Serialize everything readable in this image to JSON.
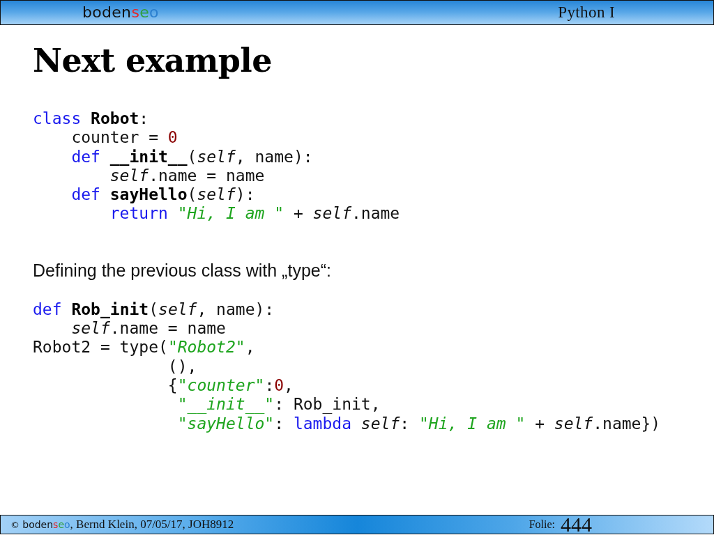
{
  "header": {
    "logo": [
      {
        "text": "boden",
        "color": "#111111"
      },
      {
        "text": "s",
        "color": "#e3262b"
      },
      {
        "text": "e",
        "color": "#2f9e3f"
      },
      {
        "text": "o",
        "color": "#2a7fcf"
      }
    ],
    "course": "Python I"
  },
  "slide": {
    "title": "Next example",
    "blocks": [
      {
        "kind": "code",
        "lines": [
          {
            "tokens": [
              {
                "kind": "kw",
                "text": "class "
              },
              {
                "kind": "name",
                "text": "Robot"
              },
              {
                "kind": "plain",
                "text": ":"
              }
            ],
            "children": [
              {
                "tokens": [
                  {
                    "kind": "plain",
                    "text": "counter = "
                  },
                  {
                    "kind": "num",
                    "text": "0"
                  }
                ]
              },
              {
                "tokens": [
                  {
                    "kind": "kw",
                    "text": "def "
                  },
                  {
                    "kind": "name",
                    "text": "__init__"
                  },
                  {
                    "kind": "plain",
                    "text": "("
                  },
                  {
                    "kind": "self",
                    "text": "self"
                  },
                  {
                    "kind": "plain",
                    "text": ", name):"
                  }
                ],
                "children": [
                  {
                    "tokens": [
                      {
                        "kind": "self",
                        "text": "self"
                      },
                      {
                        "kind": "plain",
                        "text": ".name = name"
                      }
                    ]
                  }
                ]
              },
              {
                "tokens": [
                  {
                    "kind": "kw",
                    "text": "def "
                  },
                  {
                    "kind": "name",
                    "text": "sayHello"
                  },
                  {
                    "kind": "plain",
                    "text": "("
                  },
                  {
                    "kind": "self",
                    "text": "self"
                  },
                  {
                    "kind": "plain",
                    "text": "):"
                  }
                ],
                "children": [
                  {
                    "tokens": [
                      {
                        "kind": "kw",
                        "text": "return "
                      },
                      {
                        "kind": "quote",
                        "text": "\""
                      },
                      {
                        "kind": "str",
                        "text": "Hi, I am "
                      },
                      {
                        "kind": "quote",
                        "text": "\""
                      },
                      {
                        "kind": "plain",
                        "text": " + "
                      },
                      {
                        "kind": "self",
                        "text": "self"
                      },
                      {
                        "kind": "plain",
                        "text": ".name"
                      }
                    ]
                  }
                ]
              }
            ]
          }
        ]
      },
      {
        "kind": "text",
        "text": "Defining the previous class with „type“:"
      },
      {
        "kind": "code",
        "lines": [
          {
            "tokens": [
              {
                "kind": "kw",
                "text": "def "
              },
              {
                "kind": "name",
                "text": "Rob_init"
              },
              {
                "kind": "plain",
                "text": "("
              },
              {
                "kind": "self",
                "text": "self"
              },
              {
                "kind": "plain",
                "text": ", name):"
              }
            ],
            "children": [
              {
                "tokens": [
                  {
                    "kind": "self",
                    "text": "self"
                  },
                  {
                    "kind": "plain",
                    "text": ".name = name"
                  }
                ]
              }
            ]
          },
          {
            "tokens": [
              {
                "kind": "plain",
                "text": "Robot2 = type"
              },
              {
                "kind": "open",
                "text": "("
              },
              {
                "kind": "quote",
                "text": "\""
              },
              {
                "kind": "str",
                "text": "Robot2"
              },
              {
                "kind": "quote",
                "text": "\""
              },
              {
                "kind": "plain",
                "text": ","
              }
            ],
            "children": [
              {
                "tokens": [
                  {
                    "kind": "plain",
                    "text": "(),"
                  }
                ]
              },
              {
                "tokens": [
                  {
                    "kind": "open",
                    "text": "{"
                  },
                  {
                    "kind": "quote",
                    "text": "\""
                  },
                  {
                    "kind": "str",
                    "text": "counter"
                  },
                  {
                    "kind": "quote",
                    "text": "\""
                  },
                  {
                    "kind": "plain",
                    "text": ":"
                  },
                  {
                    "kind": "num",
                    "text": "0"
                  },
                  {
                    "kind": "plain",
                    "text": ","
                  }
                ],
                "children": [
                  {
                    "tokens": [
                      {
                        "kind": "quote",
                        "text": "\""
                      },
                      {
                        "kind": "str",
                        "text": "__init__"
                      },
                      {
                        "kind": "quote",
                        "text": "\""
                      },
                      {
                        "kind": "plain",
                        "text": ": Rob_init,"
                      }
                    ]
                  },
                  {
                    "tokens": [
                      {
                        "kind": "quote",
                        "text": "\""
                      },
                      {
                        "kind": "str",
                        "text": "sayHello"
                      },
                      {
                        "kind": "quote",
                        "text": "\""
                      },
                      {
                        "kind": "plain",
                        "text": ": "
                      },
                      {
                        "kind": "kw",
                        "text": "lambda "
                      },
                      {
                        "kind": "self",
                        "text": "self"
                      },
                      {
                        "kind": "plain",
                        "text": ": "
                      },
                      {
                        "kind": "quote",
                        "text": "\""
                      },
                      {
                        "kind": "str",
                        "text": "Hi, I am "
                      },
                      {
                        "kind": "quote",
                        "text": "\""
                      },
                      {
                        "kind": "plain",
                        "text": " + "
                      },
                      {
                        "kind": "self",
                        "text": "self"
                      },
                      {
                        "kind": "plain",
                        "text": ".name})"
                      }
                    ]
                  }
                ]
              }
            ]
          }
        ]
      }
    ]
  },
  "footer": {
    "copyright_symbol": "©",
    "logo": [
      {
        "text": "boden",
        "color": "#111111"
      },
      {
        "text": "s",
        "color": "#e3262b"
      },
      {
        "text": "e",
        "color": "#2f9e3f"
      },
      {
        "text": "o",
        "color": "#2a7fcf"
      }
    ],
    "credit": ", Bernd Klein, 07/05/17, JOH8912",
    "slide_label": "Folie:",
    "slide_number": "444"
  }
}
